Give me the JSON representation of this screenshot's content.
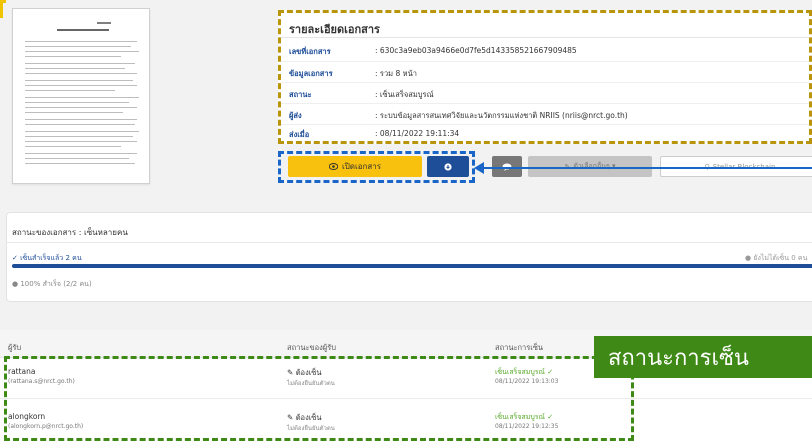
{
  "details": {
    "title": "รายละเอียดเอกสาร",
    "rows": [
      {
        "label": "เลขที่เอกสาร",
        "value": ": 630c3a9eb03a9466e0d7fe5d1433585216679094​85"
      },
      {
        "label": "ข้อมูลเอกสาร",
        "value": ": รวม 8 หน้า"
      },
      {
        "label": "สถานะ",
        "value": ": เซ็นเสร็จสมบูรณ์"
      },
      {
        "label": "ผู้ส่ง",
        "value": ": ระบบข้อมูลสารสนเทศวิจัยและนวัตกรรมแห่งชาติ NRIIS (nriis@nrct.go.th)"
      },
      {
        "label": "ส่งเมื่อ",
        "value": ": 08/11/2022 19:11:34"
      }
    ]
  },
  "actions": {
    "open_label": "เปิดเอกสาร",
    "open_icon": "eye-icon",
    "download_icon": "download-icon",
    "comment_icon": "comment-icon",
    "more_label": "ตัวเลือกอื่นๆ ▾",
    "stellar_label": "Stellar Blockchain"
  },
  "status": {
    "title": "สถานะของเอกสาร : เซ็นหลายคน",
    "signed_label": "เซ็นสำเร็จแล้ว 2 คน",
    "unsigned_label": "ยังไม่ได้เซ็น 0 คน",
    "progress_percent": 100,
    "progress_text": "100% สำเร็จ (2/2 คน)"
  },
  "signers": {
    "headers": [
      "ผู้รับ",
      "สถานะของผู้รับ",
      "สถานะการเซ็น"
    ],
    "rows": [
      {
        "name": "rattana",
        "email": "(rattana.s@nrct.go.th)",
        "recipient_status": "ต้องเซ็น",
        "recipient_note": "ไม่ต้องยืนยันตัวตน",
        "sign_status": "เซ็นเสร็จสมบูรณ์ ✓",
        "sign_time": "08/11/2022 19:13:03"
      },
      {
        "name": "alongkorn",
        "email": "(alongkorn.p@nrct.go.th)",
        "recipient_status": "ต้องเซ็น",
        "recipient_note": "ไม่ต้องยืนยันตัวตน",
        "sign_status": "เซ็นเสร็จสมบูรณ์ ✓",
        "sign_time": "08/11/2022 19:12:35"
      }
    ]
  },
  "callout": {
    "text": "สถานะการเซ็น"
  },
  "colors": {
    "accent_blue": "#1f4e99",
    "button_yellow": "#f7c10e",
    "success_green": "#59a82c",
    "highlight_gold": "#b8950b",
    "highlight_blue": "#1a66c8",
    "highlight_green": "#3f8a16"
  }
}
